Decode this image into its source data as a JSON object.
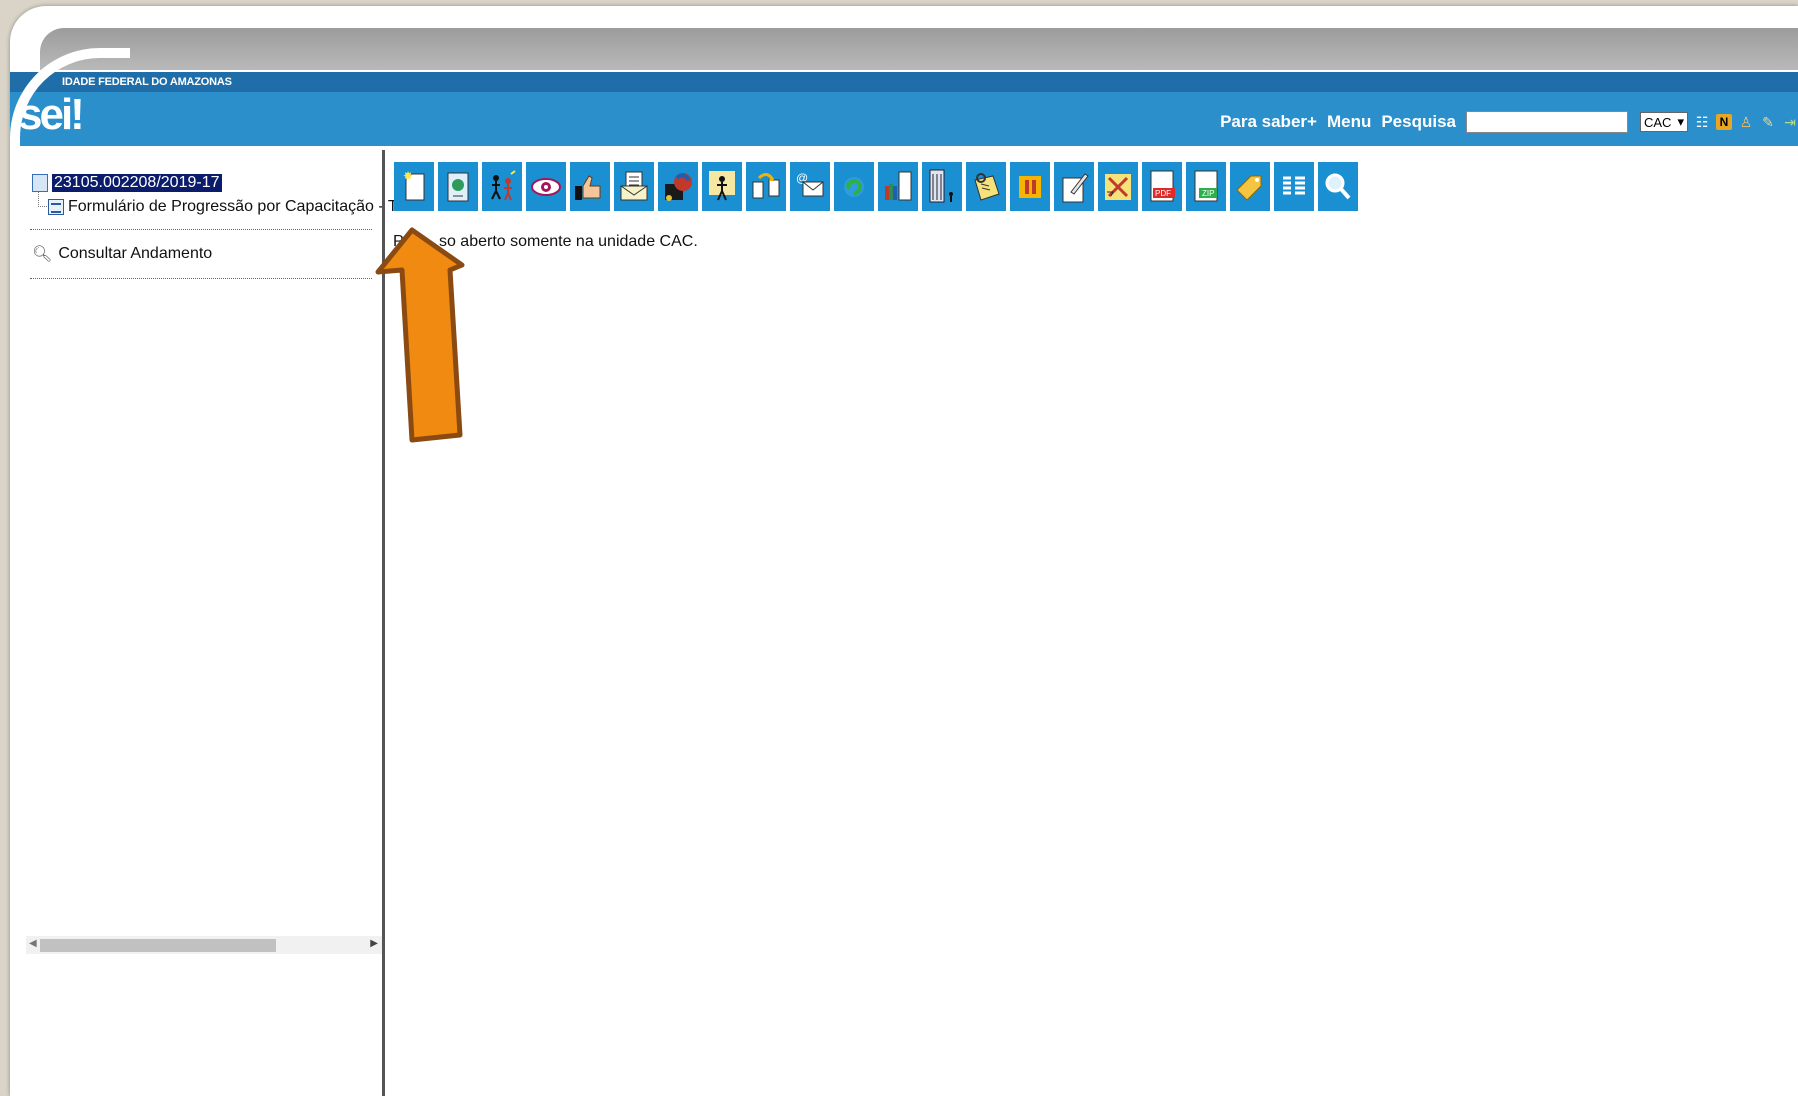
{
  "header": {
    "institution": "UNIVERSIDADE FEDERAL DO AMAZONAS",
    "institution_visible": "IDADE FEDERAL DO AMAZONAS",
    "logo": "sei",
    "logo_dot": "!",
    "links": [
      "Para saber+",
      "Menu",
      "Pesquisa"
    ],
    "search_value": "",
    "unit": "CAC",
    "icons": [
      "list-icon",
      "notes-icon",
      "user-icon",
      "tools-icon",
      "exit-icon"
    ]
  },
  "tree": {
    "process_number": "23105.002208/2019-17",
    "document_label": "Formulário de Progressão por Capacitação - TA",
    "consult_label": "Consultar Andamento"
  },
  "toolbar": {
    "icons": [
      "new-document-icon",
      "start-related-process-icon",
      "assign-process-icon",
      "follow-process-icon",
      "approve-icon",
      "send-process-icon",
      "update-progress-icon",
      "assign-person-icon",
      "relate-process-icon",
      "send-email-icon",
      "reopen-icon",
      "include-in-block-icon",
      "manage-interested-icon",
      "annotate-icon",
      "suspend-icon",
      "edit-process-icon",
      "conclude-process-icon",
      "generate-pdf-icon",
      "generate-zip-icon",
      "marker-icon",
      "list-documents-icon",
      "search-icon"
    ]
  },
  "main": {
    "status_message": "Processo aberto somente na unidade CAC.",
    "status_visible": "P        so aberto somente na unidade CAC."
  },
  "annotation": {
    "arrow_color": "#f08a10",
    "arrow_stroke": "#8a4a12"
  }
}
